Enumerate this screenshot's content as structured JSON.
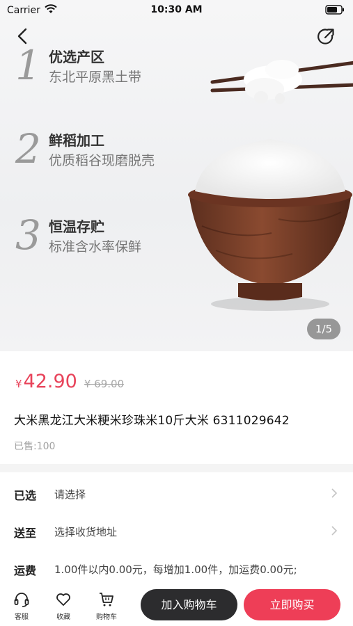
{
  "status_bar": {
    "carrier": "Carrier",
    "time": "10:30 AM"
  },
  "hero": {
    "features": [
      {
        "num": "1",
        "title": "优选产区",
        "subtitle": "东北平原黑土带"
      },
      {
        "num": "2",
        "title": "鲜稻加工",
        "subtitle": "优质稻谷现磨脱壳"
      },
      {
        "num": "3",
        "title": "恒温存贮",
        "subtitle": "标准含水率保鲜"
      }
    ],
    "page_indicator": "1/5"
  },
  "product": {
    "currency": "¥",
    "price": "42.90",
    "original_price": "¥ 69.00",
    "title": "大米黑龙江大米粳米珍珠米10斤大米  6311029642",
    "sold": "已售:100"
  },
  "options": {
    "selected": {
      "label": "已选",
      "value": "请选择"
    },
    "ship_to": {
      "label": "送至",
      "value": "选择收货地址"
    },
    "freight": {
      "label": "运费",
      "value": "1.00件以内0.00元，每增加1.00件，加运费0.00元;"
    }
  },
  "bottom_bar": {
    "service": "客服",
    "favorite": "收藏",
    "cart": "购物车",
    "add_to_cart": "加入购物车",
    "buy_now": "立即购买"
  },
  "colors": {
    "accent": "#ee3e57",
    "price": "#e8435a",
    "dark_button": "#2c2c2e"
  },
  "icons": [
    "wifi-icon",
    "battery-icon",
    "back-icon",
    "share-icon",
    "chevron-right-icon",
    "headset-icon",
    "heart-icon",
    "cart-icon"
  ]
}
